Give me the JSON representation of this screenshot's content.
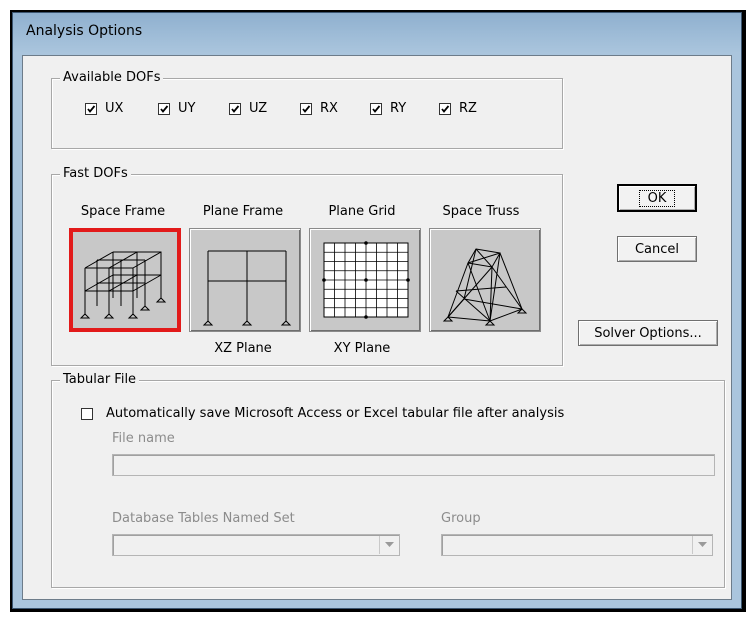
{
  "window": {
    "title": "Analysis Options"
  },
  "available_dofs": {
    "legend": "Available DOFs",
    "items": [
      {
        "label": "UX",
        "checked": true
      },
      {
        "label": "UY",
        "checked": true
      },
      {
        "label": "UZ",
        "checked": true
      },
      {
        "label": "RX",
        "checked": true
      },
      {
        "label": "RY",
        "checked": true
      },
      {
        "label": "RZ",
        "checked": true
      }
    ]
  },
  "fast_dofs": {
    "legend": "Fast DOFs",
    "options": [
      {
        "label": "Space Frame",
        "sublabel": "",
        "icon": "space-frame-icon",
        "selected": true
      },
      {
        "label": "Plane Frame",
        "sublabel": "XZ Plane",
        "icon": "plane-frame-icon",
        "selected": false
      },
      {
        "label": "Plane Grid",
        "sublabel": "XY Plane",
        "icon": "plane-grid-icon",
        "selected": false
      },
      {
        "label": "Space Truss",
        "sublabel": "",
        "icon": "space-truss-icon",
        "selected": false
      }
    ]
  },
  "buttons": {
    "ok": "OK",
    "cancel": "Cancel",
    "solver_options": "Solver Options..."
  },
  "tabular_file": {
    "legend": "Tabular File",
    "auto_save_label": "Automatically save Microsoft Access or Excel tabular file after analysis",
    "auto_save_checked": false,
    "file_name_label": "File name",
    "file_name_value": "",
    "named_set_label": "Database Tables Named Set",
    "named_set_value": "",
    "group_label": "Group",
    "group_value": ""
  },
  "colors": {
    "selection": "#e21a1a",
    "tile": "#c8c8c8",
    "titlebar": "#aac5dd"
  }
}
